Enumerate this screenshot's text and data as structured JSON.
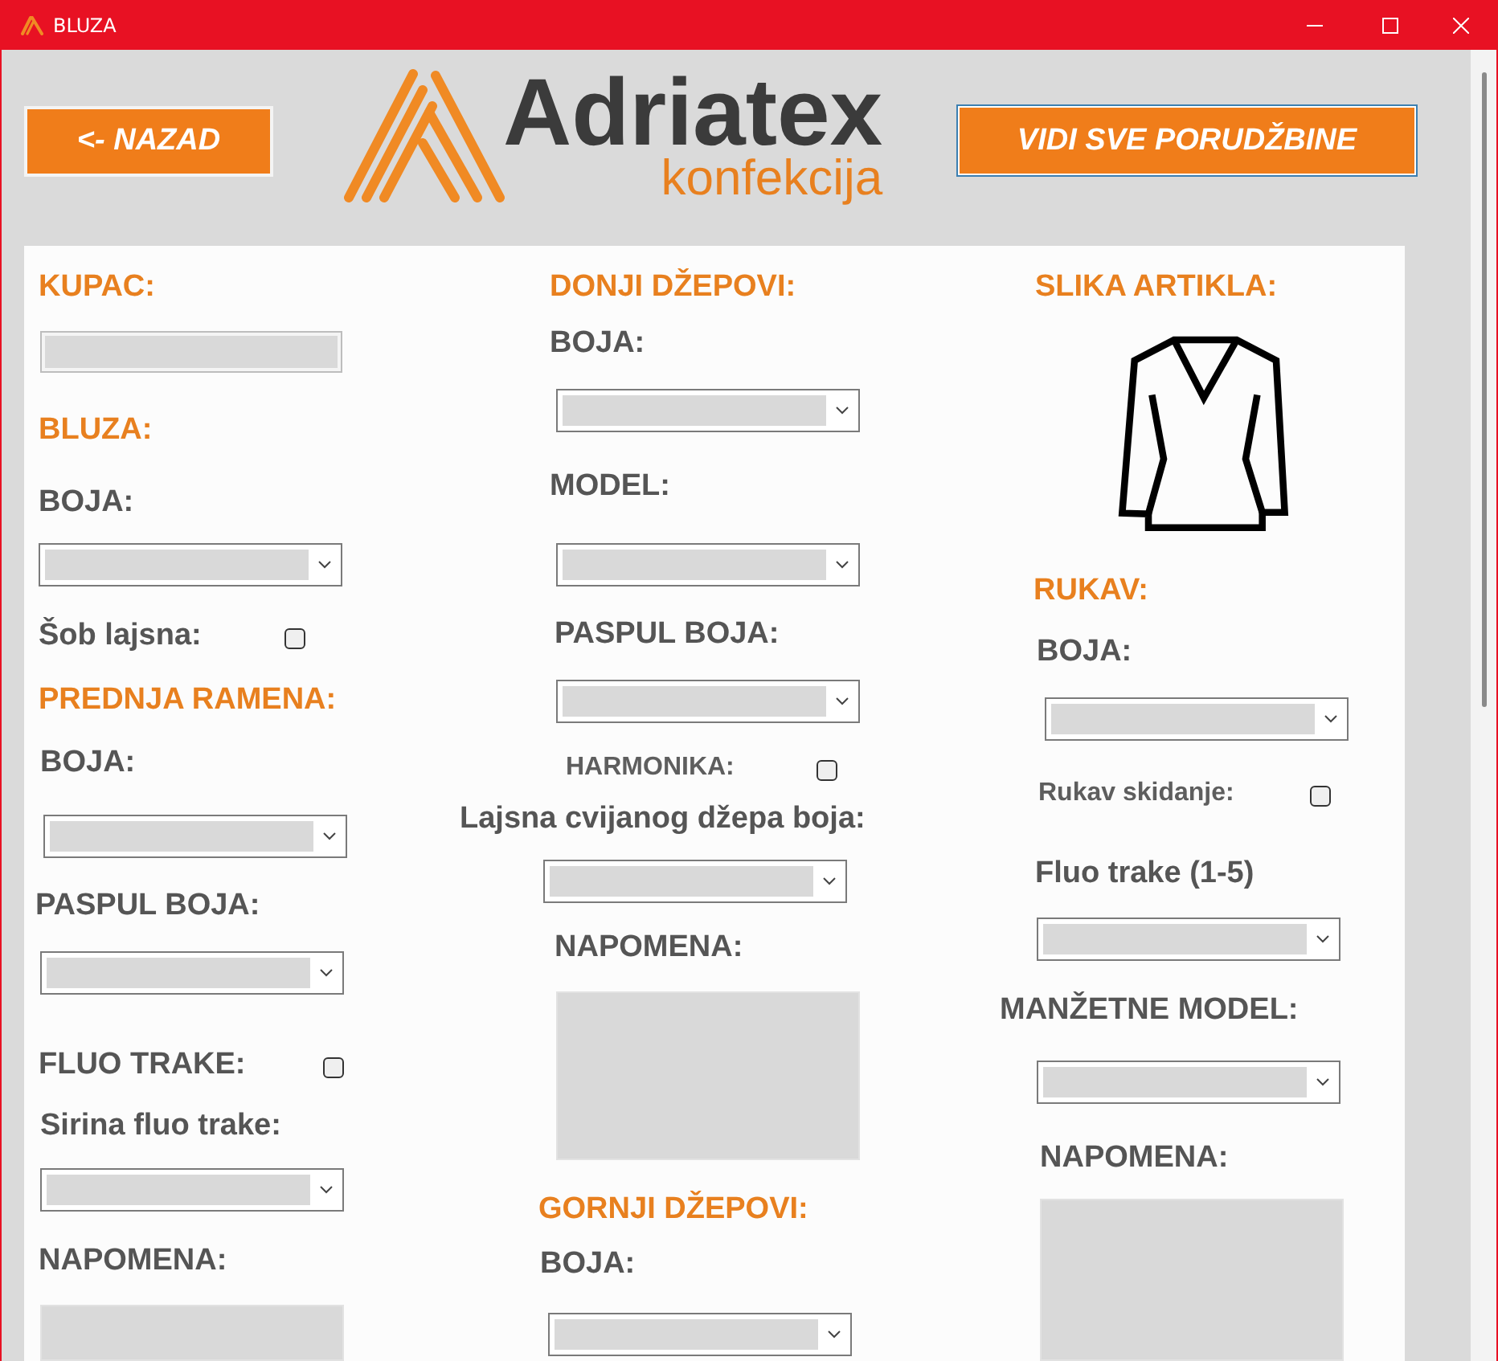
{
  "window": {
    "title": "BLUZA"
  },
  "header": {
    "back_button": "<- NAZAD",
    "logo": {
      "name": "Adriatex",
      "subtitle": "konfekcija"
    },
    "orders_button": "VIDI SVE PORUDŽBINE"
  },
  "columns": [
    {
      "items": [
        {
          "kind": "heading",
          "text": "KUPAC:"
        },
        {
          "kind": "field"
        },
        {
          "kind": "heading",
          "text": "BLUZA:"
        },
        {
          "kind": "label",
          "text": "BOJA:"
        },
        {
          "kind": "dropdown"
        },
        {
          "kind": "checkbox",
          "label": "Šob lajsna:",
          "checked": false
        },
        {
          "kind": "heading",
          "text": "PREDNJA RAMENA:"
        },
        {
          "kind": "label",
          "text": "BOJA:"
        },
        {
          "kind": "dropdown"
        },
        {
          "kind": "label",
          "text": "PASPUL BOJA:"
        },
        {
          "kind": "dropdown"
        },
        {
          "kind": "checkbox",
          "label": "FLUO TRAKE:",
          "checked": false
        },
        {
          "kind": "label",
          "text": "Sirina fluo trake:"
        },
        {
          "kind": "dropdown"
        },
        {
          "kind": "label",
          "text": "NAPOMENA:"
        },
        {
          "kind": "notes"
        }
      ]
    },
    {
      "items": [
        {
          "kind": "heading",
          "text": "DONJI DŽEPOVI:"
        },
        {
          "kind": "label",
          "text": "BOJA:"
        },
        {
          "kind": "dropdown"
        },
        {
          "kind": "label",
          "text": "MODEL:"
        },
        {
          "kind": "dropdown"
        },
        {
          "kind": "label",
          "text": "PASPUL BOJA:"
        },
        {
          "kind": "dropdown"
        },
        {
          "kind": "checkbox",
          "label": "HARMONIKA:",
          "checked": false
        },
        {
          "kind": "label",
          "text": "Lajsna cvijanog džepa boja:"
        },
        {
          "kind": "dropdown"
        },
        {
          "kind": "label",
          "text": "NAPOMENA:"
        },
        {
          "kind": "notes"
        },
        {
          "kind": "heading",
          "text": "GORNJI DŽEPOVI:"
        },
        {
          "kind": "label",
          "text": "BOJA:"
        },
        {
          "kind": "dropdown"
        }
      ]
    },
    {
      "items": [
        {
          "kind": "heading",
          "text": "SLIKA ARTIKLA:"
        },
        {
          "kind": "picture"
        },
        {
          "kind": "heading",
          "text": "RUKAV:"
        },
        {
          "kind": "label",
          "text": "BOJA:"
        },
        {
          "kind": "dropdown"
        },
        {
          "kind": "checkbox",
          "label": "Rukav skidanje:",
          "checked": false
        },
        {
          "kind": "label",
          "text": "Fluo trake (1-5)"
        },
        {
          "kind": "dropdown"
        },
        {
          "kind": "label",
          "text": "MANŽETNE MODEL:"
        },
        {
          "kind": "dropdown"
        },
        {
          "kind": "label",
          "text": "NAPOMENA:"
        },
        {
          "kind": "notes"
        }
      ]
    }
  ]
}
